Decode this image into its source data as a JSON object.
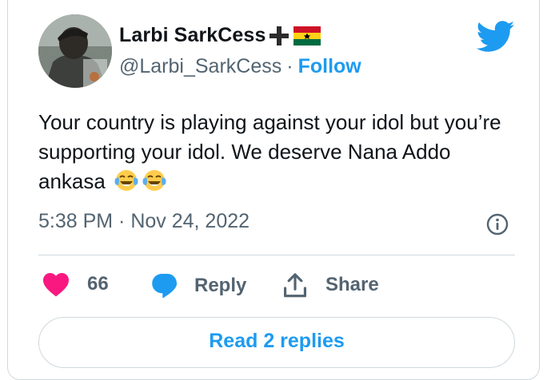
{
  "author": {
    "display_name": "Larbi SarkCess",
    "handle": "@Larbi_SarkCess",
    "separator": "·",
    "follow_label": "Follow",
    "flag_emojis": [
      "heavy-plus-sign",
      "ghana-flag"
    ]
  },
  "tweet": {
    "text": "Your country is playing against your idol but you’re supporting your idol. We deserve Nana Addo ankasa",
    "emojis": [
      "face-with-tears-of-joy",
      "face-with-tears-of-joy"
    ],
    "timestamp": "5:38 PM · Nov 24, 2022"
  },
  "actions": {
    "like_count": "66",
    "reply_label": "Reply",
    "share_label": "Share"
  },
  "read_replies_label": "Read 2 replies",
  "colors": {
    "accent": "#1d9bf0",
    "like": "#f91880",
    "text": "#0f1419",
    "secondary_text": "#536471",
    "border": "#cfd9de"
  },
  "icons": [
    "twitter-bird-icon",
    "info-icon",
    "heart-icon",
    "reply-bubble-icon",
    "share-icon"
  ]
}
